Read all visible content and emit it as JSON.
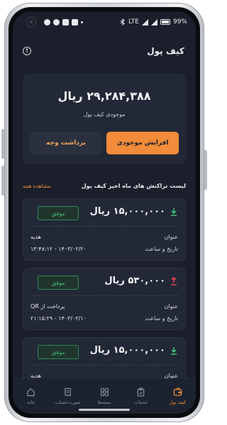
{
  "status": {
    "battery": "99%",
    "network": "LTE"
  },
  "header": {
    "title": "کیف پول"
  },
  "balance": {
    "amount": "۲۹,۲۸۴,۳۸۸ ریال",
    "label": "موجودی کیف پول",
    "increase_label": "افزایش موجودی",
    "withdraw_label": "برداشت وجه"
  },
  "transactions_section": {
    "title": "لیست تراکنش های ماه اخیر کیف پول",
    "see_all": "مشاهده همه"
  },
  "transactions": [
    {
      "amount": "۱۵,۰۰۰,۰۰۰ ریال",
      "direction": "in",
      "status": "موفق",
      "title_label": "عنوان",
      "title_value": "هدیه",
      "datetime_label": "تاریخ و ساعت",
      "datetime_value": "۱۴۰۳/۰۲/۲۰ - ۱۳:۴۸:۱۲"
    },
    {
      "amount": "۵۳۰,۰۰۰ ریال",
      "direction": "out",
      "status": "موفق",
      "title_label": "عنوان",
      "title_value": "پرداخت از QR",
      "datetime_label": "تاریخ و ساعت",
      "datetime_value": "۱۴۰۳/۰۲/۱۰ - ۲۱:۱۵:۲۹"
    },
    {
      "amount": "۱۵,۰۰۰,۰۰۰ ریال",
      "direction": "in",
      "status": "موفق",
      "title_label": "عنوان",
      "title_value": "هدیه",
      "datetime_label": "",
      "datetime_value": ""
    }
  ],
  "nav": [
    {
      "label": "کیف پول",
      "icon": "wallet-icon",
      "active": true
    },
    {
      "label": "خدمات",
      "icon": "clipboard-icon",
      "active": false
    },
    {
      "label": "بسته‌ها",
      "icon": "grid-icon",
      "active": false
    },
    {
      "label": "صورت‌حساب",
      "icon": "receipt-icon",
      "active": false
    },
    {
      "label": "خانه",
      "icon": "home-icon",
      "active": false
    }
  ],
  "colors": {
    "accent": "#f28c3a",
    "background": "#1a1f2b",
    "card": "#222836",
    "success": "#3fbf74",
    "incoming_arrow": "#3fbf74",
    "outgoing_arrow": "#e0454a"
  }
}
